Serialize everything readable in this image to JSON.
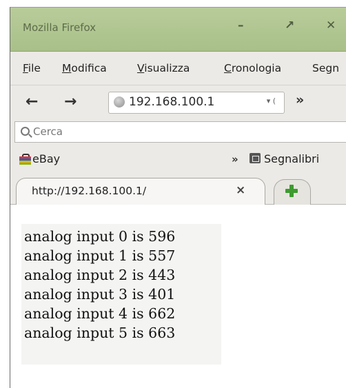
{
  "window": {
    "title": "Mozilla Firefox",
    "controls": [
      "–",
      "↗",
      "✕"
    ]
  },
  "menu": [
    {
      "accel": "F",
      "rest": "ile"
    },
    {
      "accel": "M",
      "rest": "odifica"
    },
    {
      "accel": "V",
      "rest": "isualizza"
    },
    {
      "accel": "C",
      "rest": "ronologia"
    },
    {
      "accel": "",
      "rest": "Segn"
    }
  ],
  "nav": {
    "back": "←",
    "forward": "→",
    "url": "192.168.100.1",
    "dropdown": "▾ (",
    "overflow": "»"
  },
  "search": {
    "placeholder": "Cerca"
  },
  "bookmarks": {
    "ebay": "eBay",
    "overflow": "»",
    "folder_label": "Segnalibri"
  },
  "tab": {
    "label": "http://192.168.100.1/",
    "close": "×"
  },
  "content": {
    "lines": [
      "analog input 0 is 596",
      "analog input 1 is 557",
      "analog input 2 is 443",
      "analog input 3 is 401",
      "analog input 4 is 662",
      "analog input 5 is 663"
    ]
  }
}
